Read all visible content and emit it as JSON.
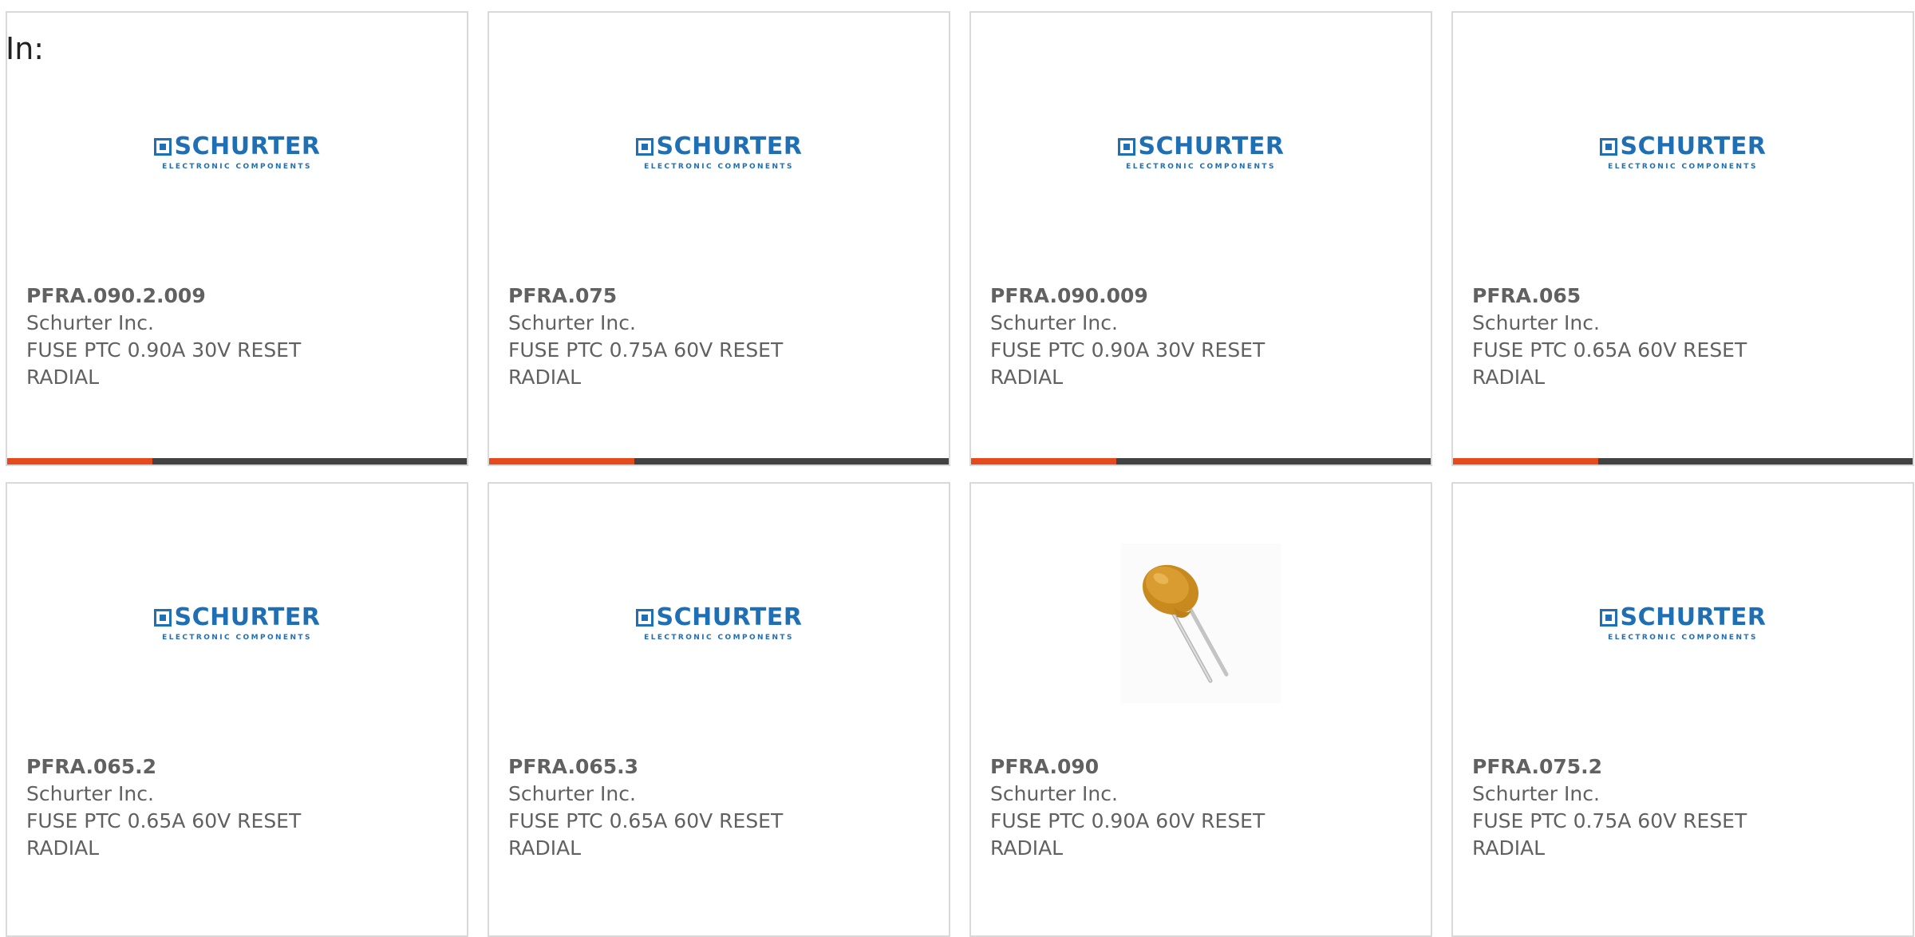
{
  "filter": {
    "label": "In:"
  },
  "products": [
    {
      "part_number": "PFRA.090.2.009",
      "manufacturer": "Schurter Inc.",
      "description_line1": "FUSE PTC 0.90A 30V RESET",
      "description_line2": "RADIAL",
      "image": "schurter-logo",
      "logo_text": "SCHURTER",
      "logo_subtext": "ELECTRONIC COMPONENTS"
    },
    {
      "part_number": "PFRA.075",
      "manufacturer": "Schurter Inc.",
      "description_line1": "FUSE PTC 0.75A 60V RESET",
      "description_line2": "RADIAL",
      "image": "schurter-logo",
      "logo_text": "SCHURTER",
      "logo_subtext": "ELECTRONIC COMPONENTS"
    },
    {
      "part_number": "PFRA.090.009",
      "manufacturer": "Schurter Inc.",
      "description_line1": "FUSE PTC 0.90A 30V RESET",
      "description_line2": "RADIAL",
      "image": "schurter-logo",
      "logo_text": "SCHURTER",
      "logo_subtext": "ELECTRONIC COMPONENTS"
    },
    {
      "part_number": "PFRA.065",
      "manufacturer": "Schurter Inc.",
      "description_line1": "FUSE PTC 0.65A 60V RESET",
      "description_line2": "RADIAL",
      "image": "schurter-logo",
      "logo_text": "SCHURTER",
      "logo_subtext": "ELECTRONIC COMPONENTS"
    },
    {
      "part_number": "PFRA.065.2",
      "manufacturer": "Schurter Inc.",
      "description_line1": "FUSE PTC 0.65A 60V RESET",
      "description_line2": "RADIAL",
      "image": "schurter-logo",
      "logo_text": "SCHURTER",
      "logo_subtext": "ELECTRONIC COMPONENTS"
    },
    {
      "part_number": "PFRA.065.3",
      "manufacturer": "Schurter Inc.",
      "description_line1": "FUSE PTC 0.65A 60V RESET",
      "description_line2": "RADIAL",
      "image": "schurter-logo",
      "logo_text": "SCHURTER",
      "logo_subtext": "ELECTRONIC COMPONENTS"
    },
    {
      "part_number": "PFRA.090",
      "manufacturer": "Schurter Inc.",
      "description_line1": "FUSE PTC 0.90A 60V RESET",
      "description_line2": "RADIAL",
      "image": "radial-ptc-fuse-photo"
    },
    {
      "part_number": "PFRA.075.2",
      "manufacturer": "Schurter Inc.",
      "description_line1": "FUSE PTC 0.75A 60V RESET",
      "description_line2": "RADIAL",
      "image": "schurter-logo",
      "logo_text": "SCHURTER",
      "logo_subtext": "ELECTRONIC COMPONENTS"
    }
  ],
  "colors": {
    "brand_blue": "#1f6fb5",
    "accent_orange": "#e44a1b",
    "bar_dark": "#424242",
    "text_gray": "#616161",
    "card_border": "#d9d9d9"
  }
}
